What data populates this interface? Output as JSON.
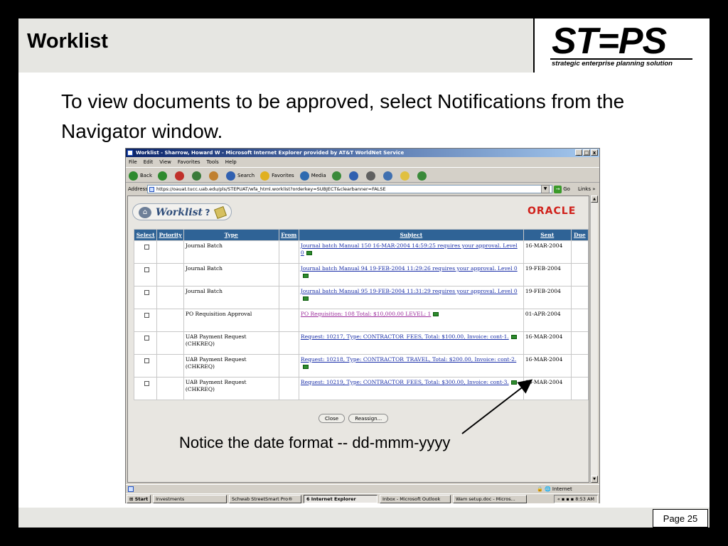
{
  "slide": {
    "title": "Worklist",
    "logo": {
      "word": "ST=PS",
      "tagline": "strategic enterprise planning solution"
    },
    "instruction": "To view documents to be approved, select Notifications from the Navigator window.",
    "callout": "Notice the date format -- dd-mmm-yyyy",
    "page_label": "Page 25"
  },
  "browser": {
    "window_title": "Worklist - Sharrow, Howard W - Microsoft Internet Explorer provided by AT&T WorldNet Service",
    "window_buttons": [
      "_",
      "□",
      "x"
    ],
    "menu": [
      "File",
      "Edit",
      "View",
      "Favorites",
      "Tools",
      "Help"
    ],
    "toolbar": [
      {
        "label": "Back",
        "icon": "back-arrow-icon",
        "color": "#2e8a2e"
      },
      {
        "label": "",
        "icon": "forward-arrow-icon",
        "color": "#2e8a2e"
      },
      {
        "label": "",
        "icon": "stop-icon",
        "color": "#c0302a"
      },
      {
        "label": "",
        "icon": "refresh-icon",
        "color": "#3a7a3a"
      },
      {
        "label": "",
        "icon": "home-icon",
        "color": "#c08030"
      },
      {
        "label": "Search",
        "icon": "search-icon",
        "color": "#3060b0"
      },
      {
        "label": "Favorites",
        "icon": "favorites-star-icon",
        "color": "#e0b020"
      },
      {
        "label": "Media",
        "icon": "media-icon",
        "color": "#2e6ab0"
      },
      {
        "label": "",
        "icon": "history-icon",
        "color": "#3a8a3a"
      },
      {
        "label": "",
        "icon": "mail-icon",
        "color": "#3060b0"
      },
      {
        "label": "",
        "icon": "print-icon",
        "color": "#606060"
      },
      {
        "label": "",
        "icon": "edit-icon",
        "color": "#4070b0"
      },
      {
        "label": "",
        "icon": "folder-icon",
        "color": "#e0c040"
      },
      {
        "label": "",
        "icon": "messenger-icon",
        "color": "#3a8a3a"
      }
    ],
    "address_label": "Address",
    "url": "https://oauat.tucc.uab.edu/pls/STEPUAT/wfa_html.worklist?orderkey=SUBJECT&clearbanner=FALSE",
    "go_label": "Go",
    "links_label": "Links",
    "status_zone": "Internet"
  },
  "worklist": {
    "title": "Worklist",
    "help": "?",
    "brand": "ORACLE",
    "columns": [
      "Select",
      "Priority",
      "Type",
      "From",
      "Subject",
      "Sent",
      "Due"
    ],
    "rows": [
      {
        "type": "Journal Batch",
        "subject": "Journal batch Manual 150 16-MAR-2004 14:59:25 requires your approval. Level 0",
        "sent": "16-MAR-2004",
        "visited": false
      },
      {
        "type": "Journal Batch",
        "subject": "Journal batch Manual 94 19-FEB-2004 11:29:26 requires your approval. Level 0",
        "sent": "19-FEB-2004",
        "visited": false
      },
      {
        "type": "Journal Batch",
        "subject": "Journal batch Manual 95 19-FEB-2004 11:31:29 requires your approval. Level 0",
        "sent": "19-FEB-2004",
        "visited": false
      },
      {
        "type": "PO Requisition Approval",
        "subject": "PO Requisition: 108 Total: $10,000.00 LEVEL: 1",
        "sent": "01-APR-2004",
        "visited": true
      },
      {
        "type": "UAB Payment Request (CHKREQ)",
        "subject": "Request: 10217, Type: CONTRACTOR_FEES, Total: $100.00, Invoice: cont-1.",
        "sent": "16-MAR-2004",
        "visited": false
      },
      {
        "type": "UAB Payment Request (CHKREQ)",
        "subject": "Request: 10218, Type: CONTRACTOR_TRAVEL, Total: $200.00, Invoice: cont-2.",
        "sent": "16-MAR-2004",
        "visited": false
      },
      {
        "type": "UAB Payment Request (CHKREQ)",
        "subject": "Request: 10219, Type: CONTRACTOR_FEES, Total: $300.00, Invoice: cont-3.",
        "sent": "16-MAR-2004",
        "visited": false
      }
    ],
    "buttons": [
      "Close",
      "Reassign..."
    ]
  },
  "taskbar": {
    "start": "Start",
    "tasks": [
      "Investments",
      "Schwab StreetSmart Pro®",
      "6 Internet Explorer",
      "Inbox - Microsoft Outlook",
      "Wam setup.doc - Micros..."
    ],
    "clock": "8:53 AM"
  },
  "colors": {
    "grid_header": "#2f6396",
    "link": "#1a2fa8",
    "visited_link": "#9b2c9b",
    "oracle_red": "#d0201a"
  }
}
